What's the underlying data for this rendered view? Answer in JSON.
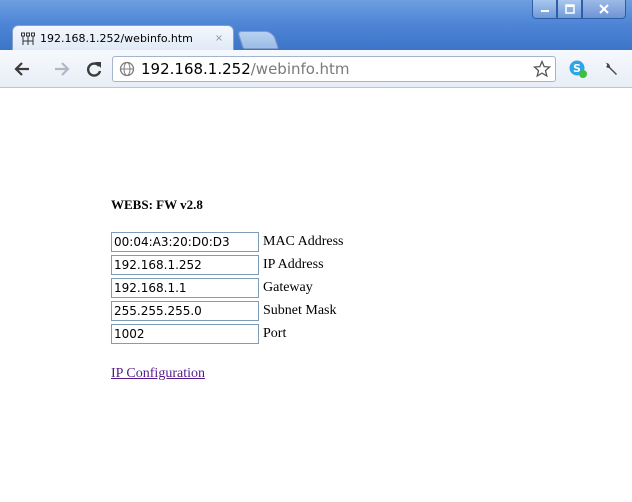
{
  "browser": {
    "tab": {
      "title": "192.168.1.252/webinfo.htm",
      "close_glyph": "×",
      "favicon": "network-icon"
    },
    "window_controls": [
      "minimize-icon",
      "maximize-icon",
      "close-icon"
    ],
    "address_bar": {
      "host": "192.168.1.252",
      "path": "/webinfo.htm",
      "icon": "globe-icon"
    },
    "toolbar_icons": [
      "back-arrow-icon",
      "forward-arrow-icon",
      "reload-icon",
      "star-icon",
      "extension-icon",
      "wrench-icon"
    ]
  },
  "page": {
    "heading": "WEBS: FW v2.8",
    "fields": [
      {
        "value": "00:04:A3:20:D0:D3",
        "label": "MAC Address"
      },
      {
        "value": "192.168.1.252",
        "label": "IP Address"
      },
      {
        "value": "192.168.1.1",
        "label": "Gateway"
      },
      {
        "value": "255.255.255.0",
        "label": "Subnet Mask"
      },
      {
        "value": "1002",
        "label": "Port"
      }
    ],
    "link": "IP Configuration"
  },
  "colors": {
    "titlebar": "#4f86d6",
    "link_visited": "#551a8b",
    "field_border": "#7f9db9"
  }
}
